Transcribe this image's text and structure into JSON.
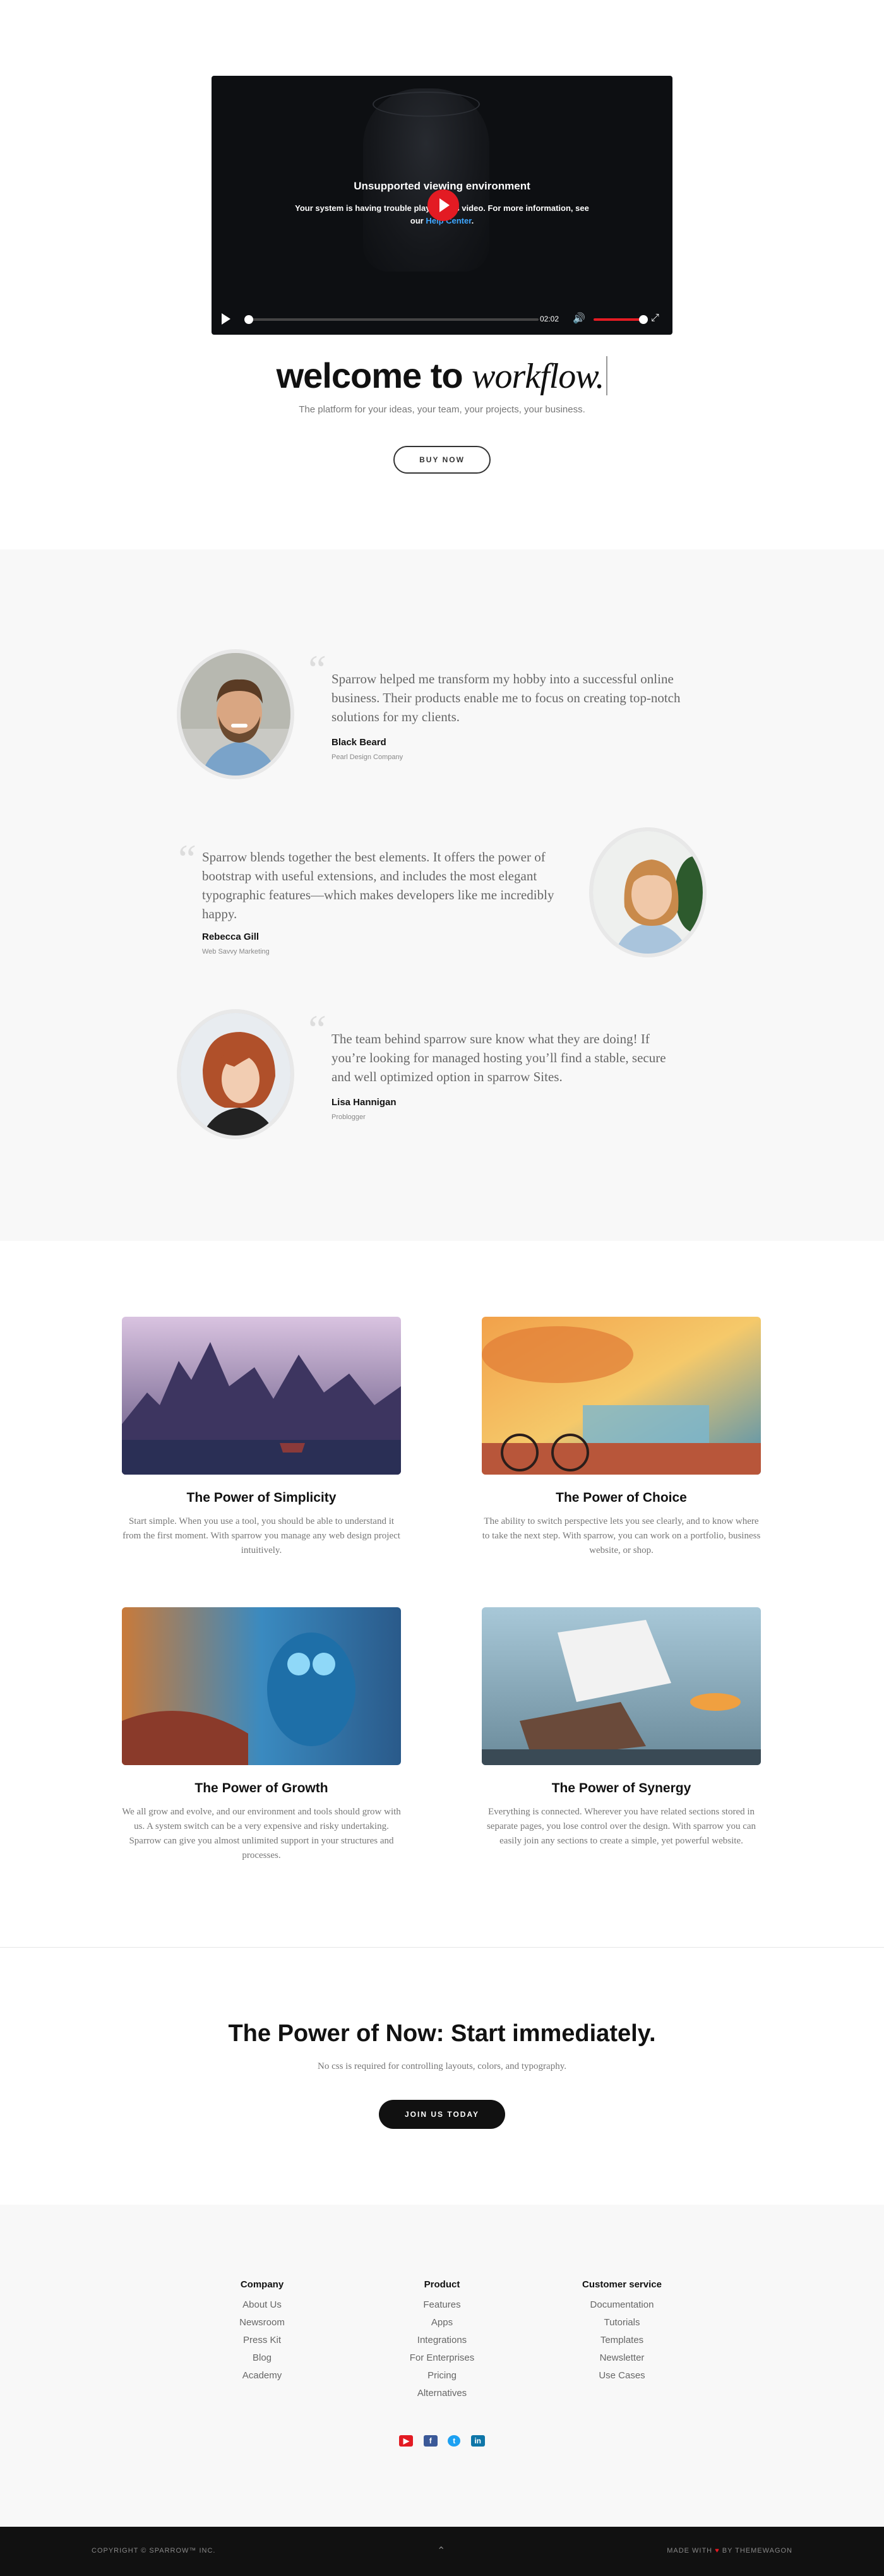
{
  "video": {
    "error_title": "Unsupported viewing environment",
    "error_text_1": "Your system is having trouble playing this video. For more information, see",
    "error_text_2_prefix": "our",
    "error_link": "Help Center",
    "time": "02:02"
  },
  "hero": {
    "welcome_bold": "welcome to",
    "welcome_italic": "workflow.",
    "subtitle": "The platform for your ideas, your team, your projects, your business.",
    "buy_label": "BUY NOW"
  },
  "testimonials": [
    {
      "quote": "Sparrow helped me transform my hobby into a successful online business. Their products enable me to focus on creating top-notch solutions for my clients.",
      "name": "Black Beard",
      "company": "Pearl Design Company"
    },
    {
      "quote": "Sparrow blends together the best elements. It offers the power of bootstrap with useful extensions, and includes the most elegant typographic features—which makes developers like me incredibly happy.",
      "name": "Rebecca Gill",
      "company": "Web Savvy Marketing"
    },
    {
      "quote": "The team behind sparrow sure know what they are doing! If you’re looking for managed hosting you’ll find a stable, secure and well optimized option in sparrow Sites.",
      "name": "Lisa Hannigan",
      "company": "Problogger"
    }
  ],
  "features": [
    {
      "title": "The Power of Simplicity",
      "text": "Start simple. When you use a tool, you should be able to understand it from the first moment. With sparrow you manage any web design project intuitively."
    },
    {
      "title": "The Power of Choice",
      "text": "The ability to switch perspective lets you see clearly, and to know where to take the next step. With sparrow, you can work on a portfolio, business website, or shop."
    },
    {
      "title": "The Power of Growth",
      "text": "We all grow and evolve, and our environment and tools should grow with us. A system switch can be a very expensive and risky undertaking. Sparrow can give you almost unlimited support in your structures and processes."
    },
    {
      "title": "The Power of Synergy",
      "text": "Everything is connected. Wherever you have related sections stored in separate pages, you lose control over the design. With sparrow you can easily join any sections to create a simple, yet powerful website."
    }
  ],
  "cta": {
    "title": "The Power of Now: Start immediately.",
    "subtitle": "No css is required for controlling layouts, colors, and typography.",
    "button_label": "JOIN US TODAY"
  },
  "footer": {
    "columns": [
      {
        "heading": "Company",
        "links": [
          "About Us",
          "Newsroom",
          "Press Kit",
          "Blog",
          "Academy"
        ]
      },
      {
        "heading": "Product",
        "links": [
          "Features",
          "Apps",
          "Integrations",
          "For Enterprises",
          "Pricing",
          "Alternatives"
        ]
      },
      {
        "heading": "Customer service",
        "links": [
          "Documentation",
          "Tutorials",
          "Templates",
          "Newsletter",
          "Use Cases"
        ]
      }
    ],
    "social_icons": [
      "youtube-icon",
      "facebook-icon",
      "twitter-icon",
      "linkedin-icon"
    ],
    "copyright": "COPYRIGHT © SPARROW™ INC.",
    "made_prefix": "MADE WITH",
    "made_heart": "♥",
    "made_suffix": "BY THEMEWAGON"
  },
  "colors": {
    "accent": "#e31b23",
    "dark": "#111111",
    "light_bg": "#f8f8f8"
  }
}
